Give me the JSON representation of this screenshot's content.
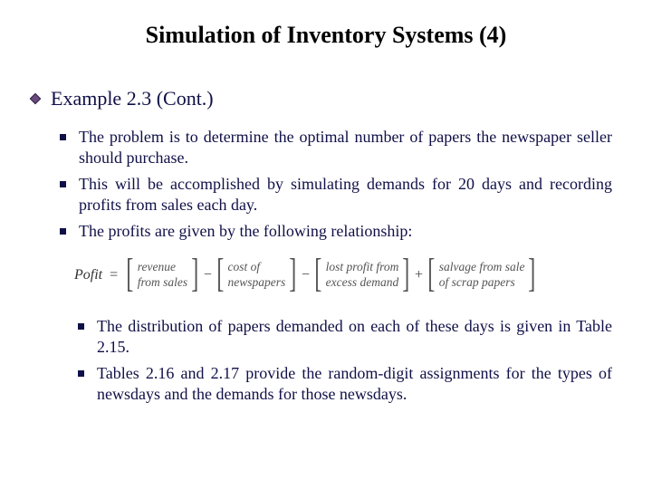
{
  "title": "Simulation of Inventory Systems (4)",
  "heading": "Example 2.3 (Cont.)",
  "bullets_a": [
    "The problem is to determine the optimal number of papers the newspaper seller should purchase.",
    "This will be accomplished by simulating demands for 20 days and recording profits from sales each day.",
    "The profits are given by the following relationship:"
  ],
  "formula": {
    "label": "Pofit",
    "eq": "=",
    "terms": [
      {
        "line1": "revenue",
        "line2": "from sales"
      },
      {
        "line1": "cost of",
        "line2": "newspapers"
      },
      {
        "line1": "lost profit from",
        "line2": "excess demand"
      },
      {
        "line1": "salvage from sale",
        "line2": "of scrap papers"
      }
    ],
    "ops": [
      "−",
      "−",
      "+"
    ]
  },
  "bullets_b": [
    "The distribution of papers demanded on each of these days is given in Table 2.15.",
    "Tables 2.16 and 2.17 provide the random-digit assignments for the types of newsdays and the demands for those newsdays."
  ]
}
